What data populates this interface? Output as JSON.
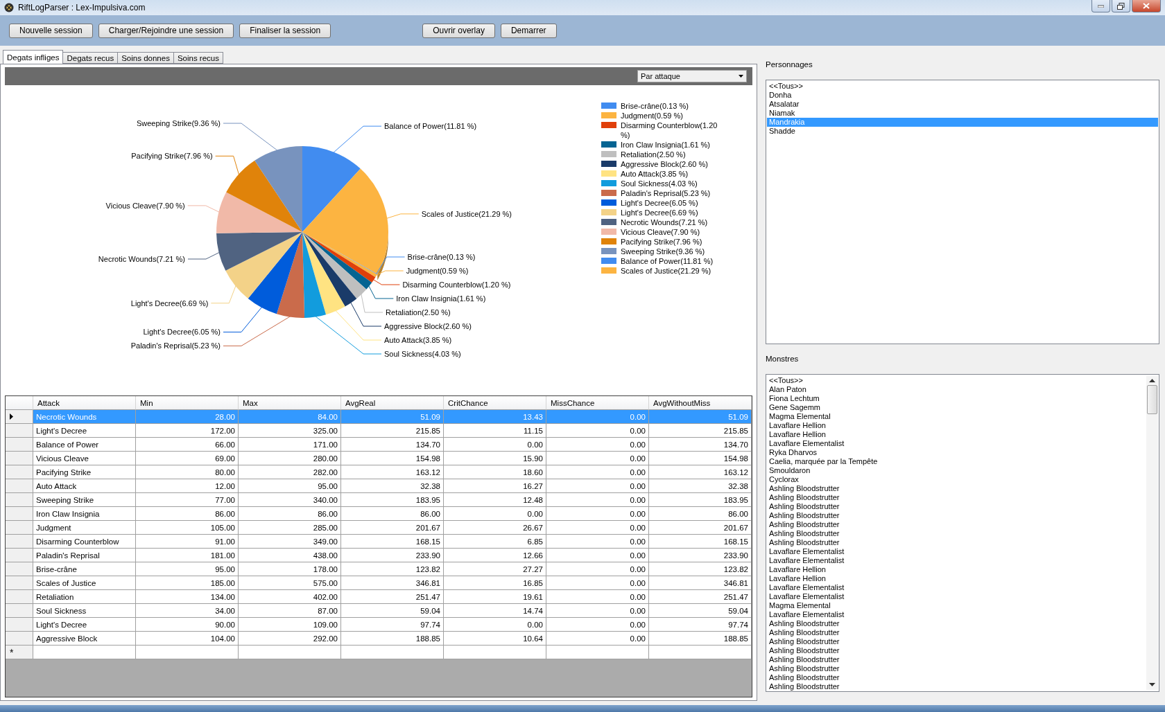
{
  "window": {
    "title": "RiftLogParser : Lex-Impulsiva.com"
  },
  "toolbar": {
    "left_buttons": [
      "Nouvelle session",
      "Charger/Rejoindre une session",
      "Finaliser la session"
    ],
    "right_buttons": [
      "Ouvrir overlay",
      "Demarrer"
    ]
  },
  "tabs": [
    {
      "label": "Degats infliges",
      "selected": true
    },
    {
      "label": "Degats recus",
      "selected": false
    },
    {
      "label": "Soins donnes",
      "selected": false
    },
    {
      "label": "Soins recus",
      "selected": false
    }
  ],
  "view_select": {
    "value": "Par attaque"
  },
  "chart_data": {
    "type": "pie",
    "legend": "right",
    "categories": [
      "Brise-crâne",
      "Judgment",
      "Disarming Counterblow",
      "Iron Claw Insignia",
      "Retaliation",
      "Aggressive Block",
      "Auto Attack",
      "Soul Sickness",
      "Paladin's Reprisal",
      "Light's Decree",
      "Light's Decree",
      "Necrotic Wounds",
      "Vicious Cleave",
      "Pacifying Strike",
      "Sweeping Strike",
      "Balance of Power",
      "Scales of Justice"
    ],
    "value_labels": [
      "(0.13 %)",
      "(0.59 %)",
      "(1.20 %)",
      "(1.61 %)",
      "(2.50 %)",
      "(2.60 %)",
      "(3.85 %)",
      "(4.03 %)",
      "(5.23 %)",
      "(6.05 %)",
      "(6.69 %)",
      "(7.21 %)",
      "(7.90 %)",
      "(7.96 %)",
      "(9.36 %)",
      "(11.81 %)",
      "(21.29 %)"
    ],
    "values": [
      0.13,
      0.59,
      1.2,
      1.61,
      2.5,
      2.6,
      3.85,
      4.03,
      5.23,
      6.05,
      6.69,
      7.21,
      7.9,
      7.96,
      9.36,
      11.81,
      21.29
    ],
    "colors": [
      "#418cf0",
      "#fcb441",
      "#e0400a",
      "#056492",
      "#bfbfbf",
      "#1a3b69",
      "#ffe382",
      "#129cdd",
      "#ca6b4b",
      "#005cdb",
      "#f3d288",
      "#506381",
      "#f1b9a8",
      "#e0830a",
      "#7893be",
      "#418cf0",
      "#fcb441"
    ]
  },
  "table": {
    "columns": [
      "Attack",
      "Min",
      "Max",
      "AvgReal",
      "CritChance",
      "MissChance",
      "AvgWithoutMiss"
    ],
    "rows": [
      {
        "cells": [
          "Necrotic Wounds",
          "28.00",
          "84.00",
          "51.09",
          "13.43",
          "0.00",
          "51.09"
        ],
        "selected": true
      },
      {
        "cells": [
          "Light's Decree",
          "172.00",
          "325.00",
          "215.85",
          "11.15",
          "0.00",
          "215.85"
        ],
        "selected": false
      },
      {
        "cells": [
          "Balance of Power",
          "66.00",
          "171.00",
          "134.70",
          "0.00",
          "0.00",
          "134.70"
        ],
        "selected": false
      },
      {
        "cells": [
          "Vicious Cleave",
          "69.00",
          "280.00",
          "154.98",
          "15.90",
          "0.00",
          "154.98"
        ],
        "selected": false
      },
      {
        "cells": [
          "Pacifying Strike",
          "80.00",
          "282.00",
          "163.12",
          "18.60",
          "0.00",
          "163.12"
        ],
        "selected": false
      },
      {
        "cells": [
          "Auto Attack",
          "12.00",
          "95.00",
          "32.38",
          "16.27",
          "0.00",
          "32.38"
        ],
        "selected": false
      },
      {
        "cells": [
          "Sweeping Strike",
          "77.00",
          "340.00",
          "183.95",
          "12.48",
          "0.00",
          "183.95"
        ],
        "selected": false
      },
      {
        "cells": [
          "Iron Claw Insignia",
          "86.00",
          "86.00",
          "86.00",
          "0.00",
          "0.00",
          "86.00"
        ],
        "selected": false
      },
      {
        "cells": [
          "Judgment",
          "105.00",
          "285.00",
          "201.67",
          "26.67",
          "0.00",
          "201.67"
        ],
        "selected": false
      },
      {
        "cells": [
          "Disarming Counterblow",
          "91.00",
          "349.00",
          "168.15",
          "6.85",
          "0.00",
          "168.15"
        ],
        "selected": false
      },
      {
        "cells": [
          "Paladin's Reprisal",
          "181.00",
          "438.00",
          "233.90",
          "12.66",
          "0.00",
          "233.90"
        ],
        "selected": false
      },
      {
        "cells": [
          "Brise-crâne",
          "95.00",
          "178.00",
          "123.82",
          "27.27",
          "0.00",
          "123.82"
        ],
        "selected": false
      },
      {
        "cells": [
          "Scales of Justice",
          "185.00",
          "575.00",
          "346.81",
          "16.85",
          "0.00",
          "346.81"
        ],
        "selected": false
      },
      {
        "cells": [
          "Retaliation",
          "134.00",
          "402.00",
          "251.47",
          "19.61",
          "0.00",
          "251.47"
        ],
        "selected": false
      },
      {
        "cells": [
          "Soul Sickness",
          "34.00",
          "87.00",
          "59.04",
          "14.74",
          "0.00",
          "59.04"
        ],
        "selected": false
      },
      {
        "cells": [
          "Light's Decree",
          "90.00",
          "109.00",
          "97.74",
          "0.00",
          "0.00",
          "97.74"
        ],
        "selected": false
      },
      {
        "cells": [
          "Aggressive Block",
          "104.00",
          "292.00",
          "188.85",
          "10.64",
          "0.00",
          "188.85"
        ],
        "selected": false
      }
    ],
    "new_row_marker": "*"
  },
  "characters": {
    "title": "Personnages",
    "items": [
      {
        "label": "<<Tous>>",
        "selected": false
      },
      {
        "label": "Donha",
        "selected": false
      },
      {
        "label": "Atsalatar",
        "selected": false
      },
      {
        "label": "Niamak",
        "selected": false
      },
      {
        "label": "Mandrakia",
        "selected": true
      },
      {
        "label": "Shadde",
        "selected": false
      }
    ]
  },
  "monsters": {
    "title": "Monstres",
    "items": [
      {
        "label": "<<Tous>>",
        "selected": false
      },
      {
        "label": "Alan Paton",
        "selected": false
      },
      {
        "label": "Fiona Lechtum",
        "selected": false
      },
      {
        "label": "Gene Sagemm",
        "selected": false
      },
      {
        "label": "Magma Elemental",
        "selected": false
      },
      {
        "label": "Lavaflare Hellion",
        "selected": false
      },
      {
        "label": "Lavaflare Hellion",
        "selected": false
      },
      {
        "label": "Lavaflare Elementalist",
        "selected": false
      },
      {
        "label": "Ryka Dharvos",
        "selected": false
      },
      {
        "label": "Caelia, marquée par la Tempête",
        "selected": false
      },
      {
        "label": "Smouldaron",
        "selected": false
      },
      {
        "label": "Cyclorax",
        "selected": false
      },
      {
        "label": "Ashling Bloodstrutter",
        "selected": false
      },
      {
        "label": "Ashling Bloodstrutter",
        "selected": false
      },
      {
        "label": "Ashling Bloodstrutter",
        "selected": false
      },
      {
        "label": "Ashling Bloodstrutter",
        "selected": false
      },
      {
        "label": "Ashling Bloodstrutter",
        "selected": false
      },
      {
        "label": "Ashling Bloodstrutter",
        "selected": false
      },
      {
        "label": "Ashling Bloodstrutter",
        "selected": false
      },
      {
        "label": "Lavaflare Elementalist",
        "selected": false
      },
      {
        "label": "Lavaflare Elementalist",
        "selected": false
      },
      {
        "label": "Lavaflare Hellion",
        "selected": false
      },
      {
        "label": "Lavaflare Hellion",
        "selected": false
      },
      {
        "label": "Lavaflare Elementalist",
        "selected": false
      },
      {
        "label": "Lavaflare Elementalist",
        "selected": false
      },
      {
        "label": "Magma Elemental",
        "selected": false
      },
      {
        "label": "Lavaflare Elementalist",
        "selected": false
      },
      {
        "label": "Ashling Bloodstrutter",
        "selected": false
      },
      {
        "label": "Ashling Bloodstrutter",
        "selected": false
      },
      {
        "label": "Ashling Bloodstrutter",
        "selected": false
      },
      {
        "label": "Ashling Bloodstrutter",
        "selected": false
      },
      {
        "label": "Ashling Bloodstrutter",
        "selected": false
      },
      {
        "label": "Ashling Bloodstrutter",
        "selected": false
      },
      {
        "label": "Ashling Bloodstrutter",
        "selected": false
      },
      {
        "label": "Ashling Bloodstrutter",
        "selected": false
      }
    ]
  }
}
